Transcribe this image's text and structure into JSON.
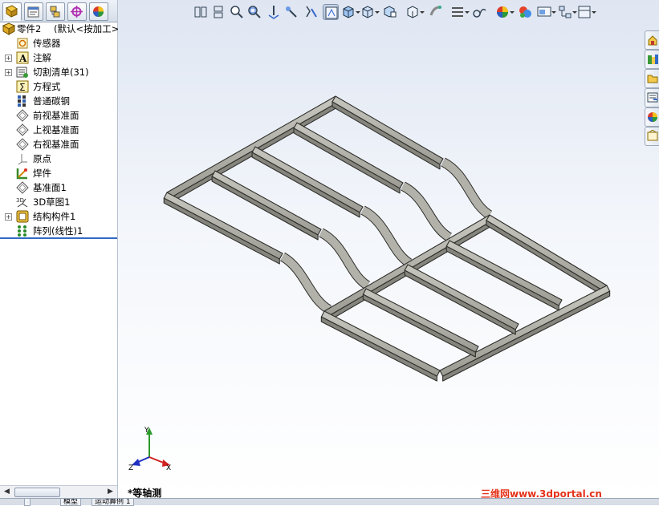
{
  "tree": {
    "root": {
      "label": "零件2",
      "config": "(默认<按加工>",
      "icon": "part-icon"
    },
    "items": [
      {
        "label": "传感器",
        "icon": "sensor-icon",
        "expandable": false
      },
      {
        "label": "注解",
        "icon": "annotations-icon",
        "expandable": true
      },
      {
        "label": "切割清单(31)",
        "icon": "cut-list-icon",
        "expandable": true
      },
      {
        "label": "方程式",
        "icon": "equations-icon",
        "expandable": false
      },
      {
        "label": "普通碳钢",
        "icon": "material-icon",
        "expandable": false
      },
      {
        "label": "前视基准面",
        "icon": "plane-icon",
        "expandable": false
      },
      {
        "label": "上视基准面",
        "icon": "plane-icon",
        "expandable": false
      },
      {
        "label": "右视基准面",
        "icon": "plane-icon",
        "expandable": false
      },
      {
        "label": "原点",
        "icon": "origin-icon",
        "expandable": false
      },
      {
        "label": "焊件",
        "icon": "weldment-icon",
        "expandable": false
      },
      {
        "label": "基准面1",
        "icon": "plane-icon",
        "expandable": false
      },
      {
        "label": "3D草图1",
        "icon": "3d-sketch-icon",
        "expandable": false
      },
      {
        "label": "结构构件1",
        "icon": "structural-member-icon",
        "expandable": true
      },
      {
        "label": "阵列(线性)1",
        "icon": "linear-pattern-icon",
        "expandable": false
      }
    ]
  },
  "panel_tabs": [
    "featuremanager-tab",
    "propertymanager-tab",
    "configurationmanager-tab",
    "dimxpert-tab",
    "display-manager-tab"
  ],
  "bottom_tabs": [
    "模型",
    "运动算例 1"
  ],
  "toolbar": [
    "view-orientation",
    "previous-view",
    "zoom-to-fit",
    "zoom-to-area",
    "3d-drawing-view",
    "section-view",
    "dynamic-annotation-views",
    "view-isometric",
    "display-style",
    "hide-show-items",
    "edit-appearance",
    "apply-scene",
    "view-settings",
    "orientation",
    "rotate-view",
    "hide-lines",
    "appearance",
    "realview",
    "shadows",
    "display-pane"
  ],
  "task_pane": [
    "solidworks-resources-icon",
    "design-library-icon",
    "file-explorer-icon",
    "view-palette-icon",
    "appearances-icon",
    "custom-properties-icon"
  ],
  "view_name": "*等轴测",
  "triad": {
    "x": "X",
    "y": "Y",
    "z": "Z"
  },
  "watermark": "三维网www.3dportal.cn",
  "colors": {
    "accent": "#3169c6",
    "frame": "#9a9a92",
    "watermark": "#e5331b"
  }
}
